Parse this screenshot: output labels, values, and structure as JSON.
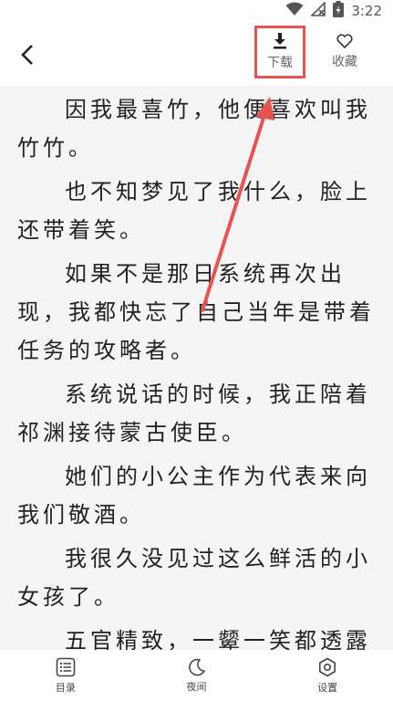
{
  "status_bar": {
    "time": "3:22"
  },
  "top_bar": {
    "download_label": "下载",
    "favorite_label": "收藏"
  },
  "content": {
    "paragraphs": [
      "因我最喜竹，他便喜欢叫我竹竹。",
      "也不知梦见了我什么，脸上还带着笑。",
      "如果不是那日系统再次出现，我都快忘了自己当年是带着任务的攻略者。",
      "系统说话的时候，我正陪着祁渊接待蒙古使臣。",
      "她们的小公主作为代表来向我们敬酒。",
      "我很久没见过这么鲜活的小女孩了。",
      "五官精致，一颦一笑都透露着爽朗大方，连我这个淡人中的"
    ]
  },
  "bottom_bar": {
    "catalog_label": "目录",
    "night_label": "夜间",
    "settings_label": "设置"
  },
  "colors": {
    "highlight": "#e8534f",
    "background": "#f5f5f5"
  }
}
